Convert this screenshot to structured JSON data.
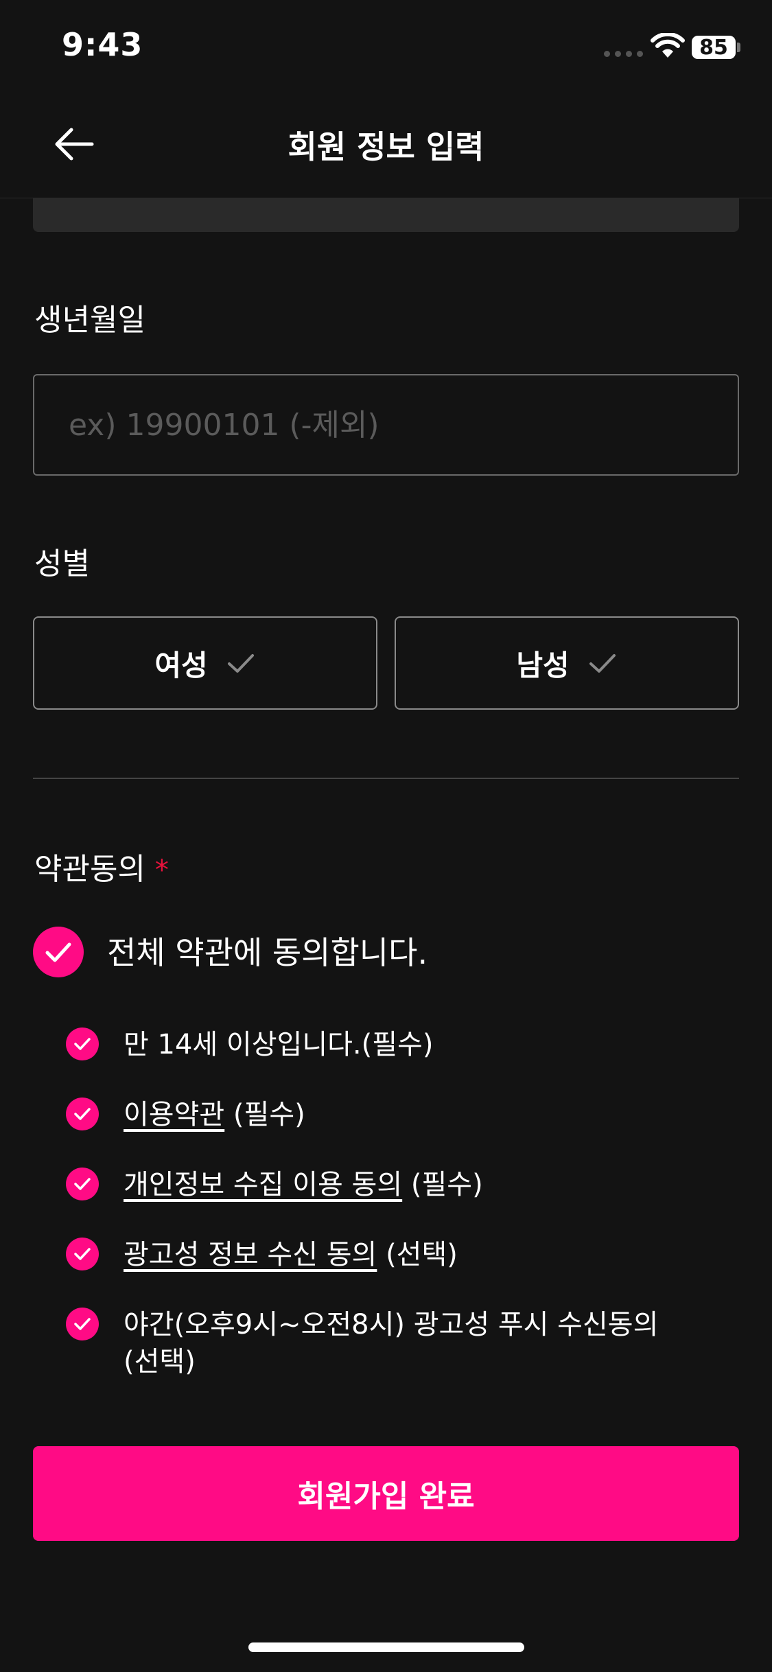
{
  "status_bar": {
    "time": "9:43",
    "battery": "85"
  },
  "header": {
    "title": "회원 정보 입력",
    "back_icon": "arrow-left-icon"
  },
  "birthdate": {
    "label": "생년월일",
    "placeholder": "ex) 19900101 (-제외)",
    "value": ""
  },
  "gender": {
    "label": "성별",
    "options": [
      {
        "label": "여성",
        "selected": false
      },
      {
        "label": "남성",
        "selected": false
      }
    ]
  },
  "terms": {
    "label": "약관동의",
    "required_mark": "*",
    "agree_all": {
      "label": "전체 약관에 동의합니다.",
      "checked": true
    },
    "items": [
      {
        "link": "",
        "text": "만 14세 이상입니다.(필수)",
        "checked": true
      },
      {
        "link": "이용약관",
        "text": " (필수)",
        "checked": true
      },
      {
        "link": "개인정보 수집 이용 동의",
        "text": " (필수)",
        "checked": true
      },
      {
        "link": "광고성 정보 수신 동의",
        "text": " (선택)",
        "checked": true
      },
      {
        "link": "",
        "text": "야간(오후9시~오전8시) 광고성 푸시 수신동의 (선택)",
        "checked": true
      }
    ]
  },
  "submit": {
    "label": "회원가입 완료"
  },
  "colors": {
    "accent": "#ff0b85",
    "background": "#131313",
    "required": "#e8123c"
  }
}
